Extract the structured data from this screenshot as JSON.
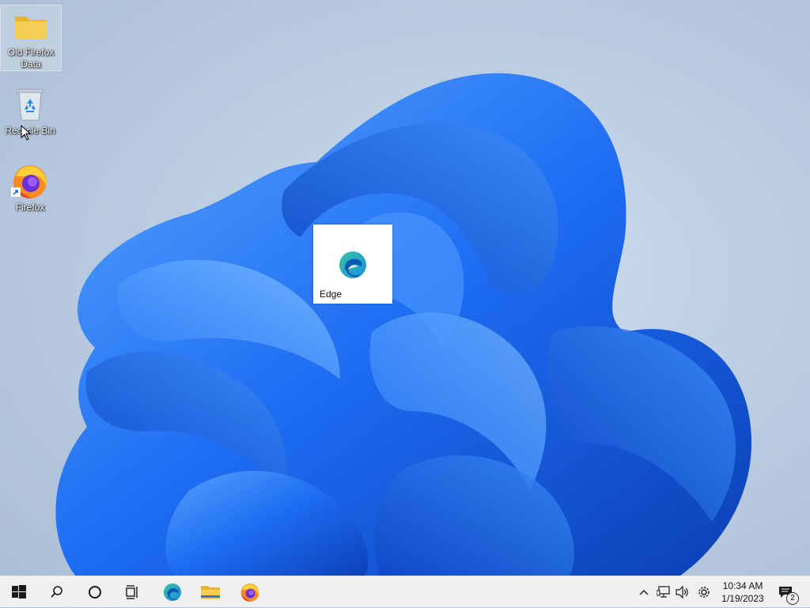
{
  "desktop": {
    "icons": [
      {
        "label": "Old Firefox Data",
        "icon": "folder-icon"
      },
      {
        "label": "Recycle Bin",
        "icon": "recycle-bin-icon"
      },
      {
        "label": "Firefox",
        "icon": "firefox-icon"
      }
    ],
    "drag_tile": {
      "label": "Edge",
      "icon": "edge-icon"
    }
  },
  "taskbar": {
    "items": [
      "start-icon",
      "search-icon",
      "cortana-icon",
      "task-view-icon",
      "edge-icon",
      "file-explorer-icon",
      "firefox-icon"
    ],
    "tray": {
      "time": "10:34 AM",
      "date": "1/19/2023",
      "notification_count": "2"
    }
  },
  "colors": {
    "taskbar_bg": "#f0f0f0",
    "wallpaper_blue": "#1f6bf0",
    "folder_yellow": "#f5c94a"
  }
}
